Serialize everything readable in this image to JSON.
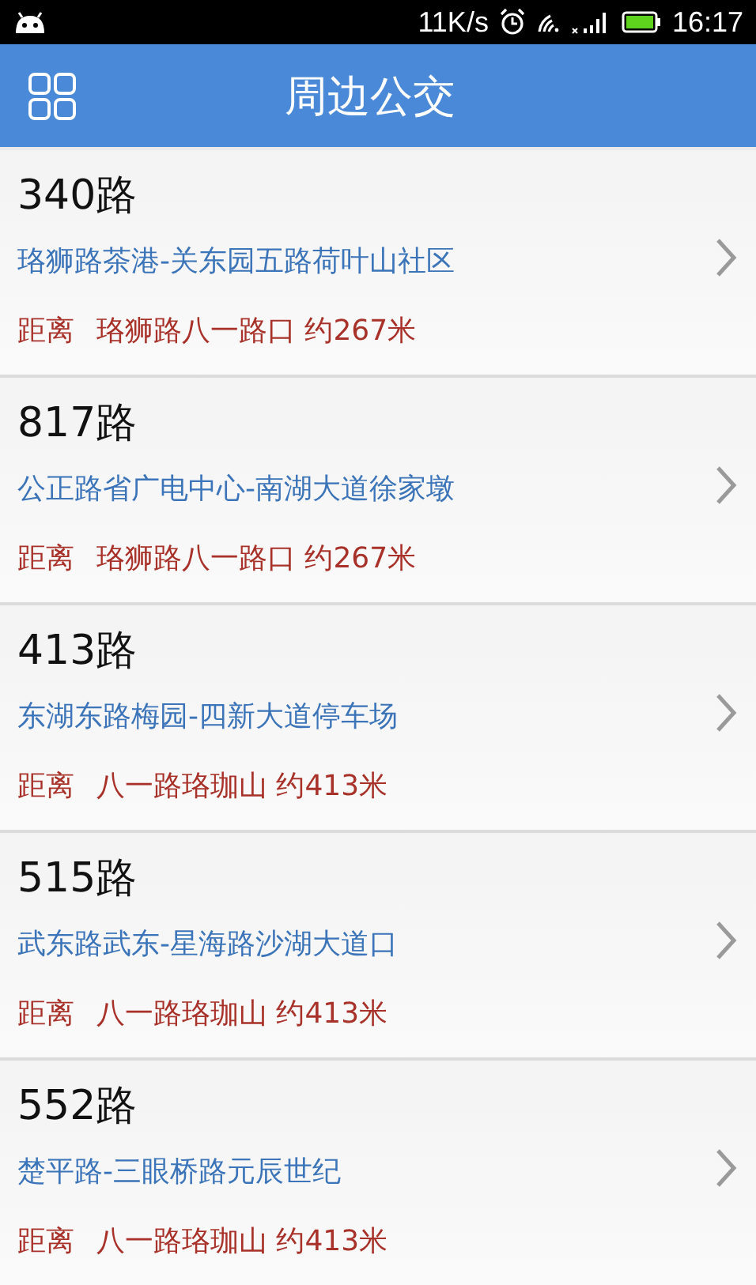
{
  "status_bar": {
    "speed": "11K/s",
    "time": "16:17"
  },
  "header": {
    "title": "周边公交"
  },
  "routes": [
    {
      "name": "340路",
      "line": "珞狮路茶港-关东园五路荷叶山社区",
      "distance_label": "距离",
      "distance": "珞狮路八一路口 约267米"
    },
    {
      "name": "817路",
      "line": "公正路省广电中心-南湖大道徐家墩",
      "distance_label": "距离",
      "distance": "珞狮路八一路口 约267米"
    },
    {
      "name": "413路",
      "line": "东湖东路梅园-四新大道停车场",
      "distance_label": "距离",
      "distance": "八一路珞珈山 约413米"
    },
    {
      "name": "515路",
      "line": "武东路武东-星海路沙湖大道口",
      "distance_label": "距离",
      "distance": "八一路珞珈山 约413米"
    },
    {
      "name": "552路",
      "line": "楚平路-三眼桥路元辰世纪",
      "distance_label": "距离",
      "distance": "八一路珞珈山 约413米"
    }
  ]
}
